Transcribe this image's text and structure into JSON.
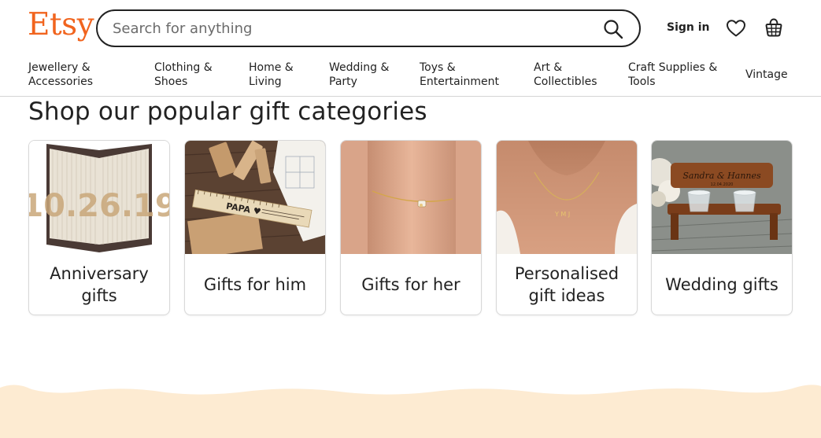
{
  "brand": {
    "logo": "Etsy",
    "accent": "#f1641e"
  },
  "search": {
    "placeholder": "Search for anything",
    "icon": "search-icon"
  },
  "account": {
    "sign_in": "Sign in",
    "favourites_icon": "heart-icon",
    "basket_icon": "basket-icon"
  },
  "categories": [
    {
      "line1": "Jewellery &",
      "line2": "Accessories"
    },
    {
      "line1": "Clothing &",
      "line2": "Shoes"
    },
    {
      "line1": "Home &",
      "line2": "Living"
    },
    {
      "line1": "Wedding &",
      "line2": "Party"
    },
    {
      "line1": "Toys &",
      "line2": "Entertainment"
    },
    {
      "line1": "Art &",
      "line2": "Collectibles"
    },
    {
      "line1": "Craft Supplies &",
      "line2": "Tools"
    },
    {
      "line1": "Vintage",
      "line2": ""
    }
  ],
  "section": {
    "title": "Shop our popular gift categories",
    "cards": [
      {
        "label": "Anniversary gifts",
        "image": "folded-book-art-image",
        "image_text": "10.26.19"
      },
      {
        "label": "Gifts for him",
        "image": "engraved-ruler-image",
        "image_text": "PAPA"
      },
      {
        "label": "Gifts for her",
        "image": "ankle-bracelet-image",
        "image_text": ""
      },
      {
        "label": "Personalised gift ideas",
        "image": "name-necklace-image",
        "image_text": ""
      },
      {
        "label": "Wedding gifts",
        "image": "engraved-shot-glass-stand-image",
        "image_text": "Sandra & Hannes 12.04.2020"
      }
    ]
  },
  "footer_wave_color": "#fdebd2"
}
